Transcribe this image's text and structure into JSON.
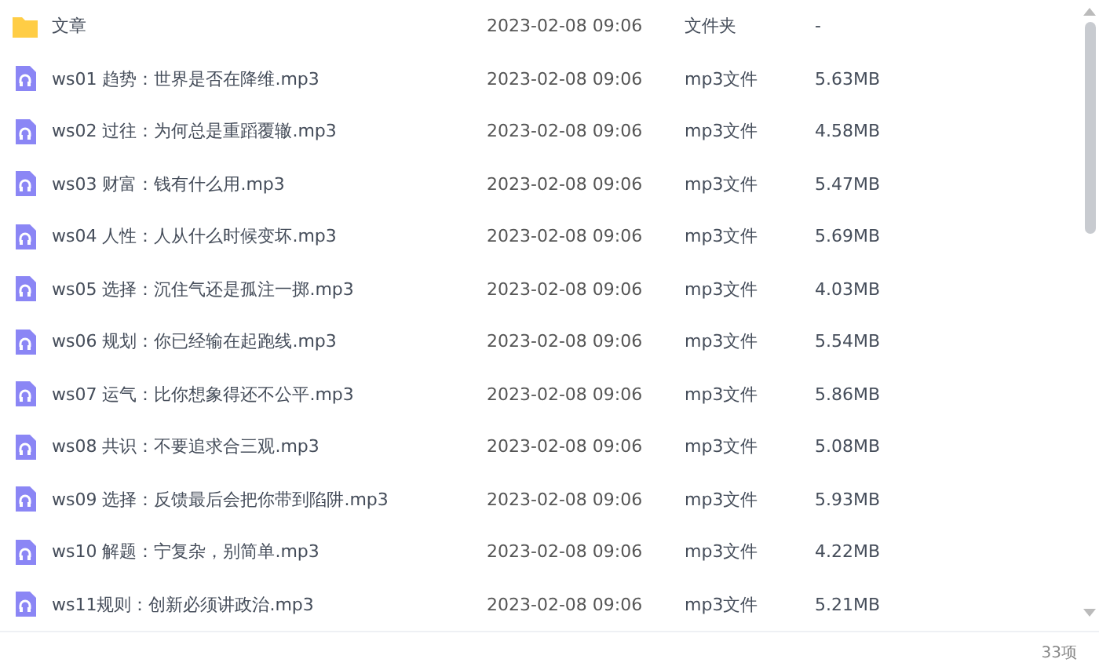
{
  "files": [
    {
      "kind": "folder",
      "name": "文章",
      "modified": "2023-02-08 09:06",
      "type": "文件夹",
      "size": "-"
    },
    {
      "kind": "audio",
      "name": "ws01 趋势：世界是否在降维.mp3",
      "modified": "2023-02-08 09:06",
      "type": "mp3文件",
      "size": "5.63MB"
    },
    {
      "kind": "audio",
      "name": "ws02 过往：为何总是重蹈覆辙.mp3",
      "modified": "2023-02-08 09:06",
      "type": "mp3文件",
      "size": "4.58MB"
    },
    {
      "kind": "audio",
      "name": "ws03 财富：钱有什么用.mp3",
      "modified": "2023-02-08 09:06",
      "type": "mp3文件",
      "size": "5.47MB"
    },
    {
      "kind": "audio",
      "name": "ws04 人性：人从什么时候变坏.mp3",
      "modified": "2023-02-08 09:06",
      "type": "mp3文件",
      "size": "5.69MB"
    },
    {
      "kind": "audio",
      "name": "ws05 选择：沉住气还是孤注一掷.mp3",
      "modified": "2023-02-08 09:06",
      "type": "mp3文件",
      "size": "4.03MB"
    },
    {
      "kind": "audio",
      "name": "ws06 规划：你已经输在起跑线.mp3",
      "modified": "2023-02-08 09:06",
      "type": "mp3文件",
      "size": "5.54MB"
    },
    {
      "kind": "audio",
      "name": "ws07 运气：比你想象得还不公平.mp3",
      "modified": "2023-02-08 09:06",
      "type": "mp3文件",
      "size": "5.86MB"
    },
    {
      "kind": "audio",
      "name": "ws08 共识：不要追求合三观.mp3",
      "modified": "2023-02-08 09:06",
      "type": "mp3文件",
      "size": "5.08MB"
    },
    {
      "kind": "audio",
      "name": "ws09 选择：反馈最后会把你带到陷阱.mp3",
      "modified": "2023-02-08 09:06",
      "type": "mp3文件",
      "size": "5.93MB"
    },
    {
      "kind": "audio",
      "name": "ws10 解题：宁复杂，别简单.mp3",
      "modified": "2023-02-08 09:06",
      "type": "mp3文件",
      "size": "4.22MB"
    },
    {
      "kind": "audio",
      "name": "ws11规则：创新必须讲政治.mp3",
      "modified": "2023-02-08 09:06",
      "type": "mp3文件",
      "size": "5.21MB"
    }
  ],
  "status_bar": {
    "count": "33项"
  }
}
